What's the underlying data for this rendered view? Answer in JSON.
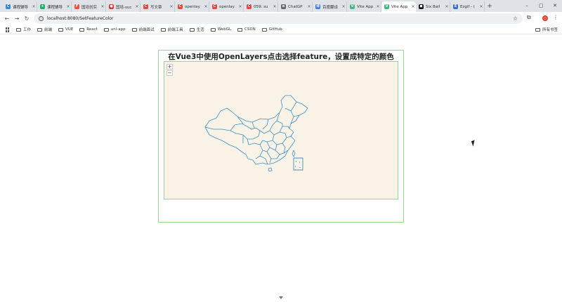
{
  "tabs": [
    {
      "title": "课程辅导",
      "color": "#2a8be0",
      "glyph": "C"
    },
    {
      "title": "课程辅导",
      "color": "#19b36b",
      "glyph": "+"
    },
    {
      "title": "国培创实",
      "color": "#e4573d",
      "glyph": "F"
    },
    {
      "title": "国培-suc",
      "color": "#d9363e",
      "glyph": "●"
    },
    {
      "title": "写文章",
      "color": "#e4473d",
      "glyph": "C"
    },
    {
      "title": "openlay",
      "color": "#e4473d",
      "glyph": "C"
    },
    {
      "title": "openlay",
      "color": "#e4473d",
      "glyph": "C"
    },
    {
      "title": "059: su",
      "color": "#e4473d",
      "glyph": "C"
    },
    {
      "title": "ChatGP",
      "color": "#666666",
      "glyph": "⊛"
    },
    {
      "title": "百度翻译",
      "color": "#3b7be0",
      "glyph": "译"
    },
    {
      "title": "Vite App",
      "color": "#41b883",
      "glyph": "V"
    },
    {
      "title": "Vite App",
      "color": "#41b883",
      "glyph": "V",
      "active": true
    },
    {
      "title": "Six Ball",
      "color": "#111111",
      "glyph": "◼"
    },
    {
      "title": "Ezgif - (",
      "color": "#3a6fc9",
      "glyph": "E"
    }
  ],
  "address": {
    "url": "localhost:8080/SetFeatureColor"
  },
  "bookmarks": [
    "工作",
    "前端",
    "VUE",
    "React",
    "uni-app",
    "前端面试",
    "前端工具",
    "生活",
    "WebGL",
    "CSDN",
    "GitHub"
  ],
  "bookmarks_right": "所有书签",
  "page": {
    "title": "在Vue3中使用OpenLayers点击选择feature，设置成特定的颜色",
    "zoom_in": "+",
    "zoom_out": "−"
  },
  "colors": {
    "map_bg": "#f9f3e7",
    "border_outline": "#3f8fbf",
    "panel_border": "#9ed19e"
  }
}
